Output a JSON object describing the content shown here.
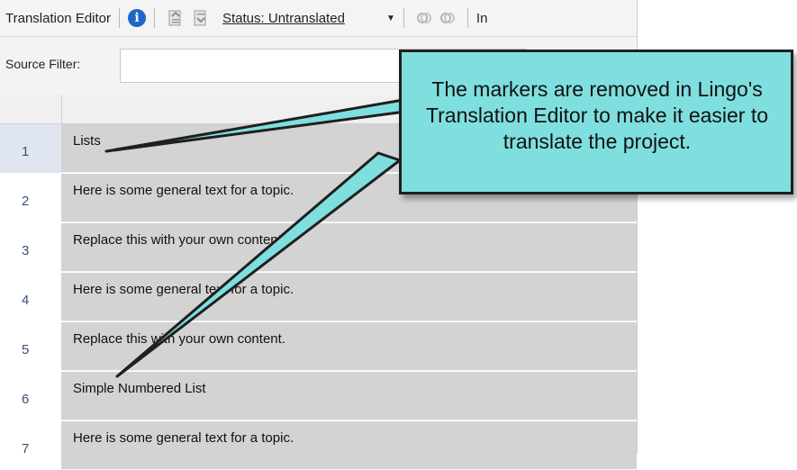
{
  "toolbar": {
    "title": "Translation Editor",
    "info_icon_glyph": "i",
    "status_label": "Status: Untranslated",
    "dropdown_glyph": "▼",
    "truncated_label": "In"
  },
  "filter": {
    "label": "Source Filter:",
    "value": ""
  },
  "grid": {
    "rows": [
      {
        "num": "1",
        "text": "Lists"
      },
      {
        "num": "2",
        "text": "Here is some general text for a topic."
      },
      {
        "num": "3",
        "text": "Replace this with your own content."
      },
      {
        "num": "4",
        "text": "Here is some general text for a topic."
      },
      {
        "num": "5",
        "text": "Replace this with your own content."
      },
      {
        "num": "6",
        "text": "Simple Numbered List"
      },
      {
        "num": "7",
        "text": "Here is some general text for a topic."
      }
    ]
  },
  "callout": {
    "text": "The markers are removed in Lingo's Translation Editor to make it easier to translate the project.",
    "fill_color": "#7fdfdf"
  },
  "icons": [
    "info-icon",
    "export-icon",
    "import-icon",
    "dropdown-arrow-icon",
    "ring-icon"
  ]
}
